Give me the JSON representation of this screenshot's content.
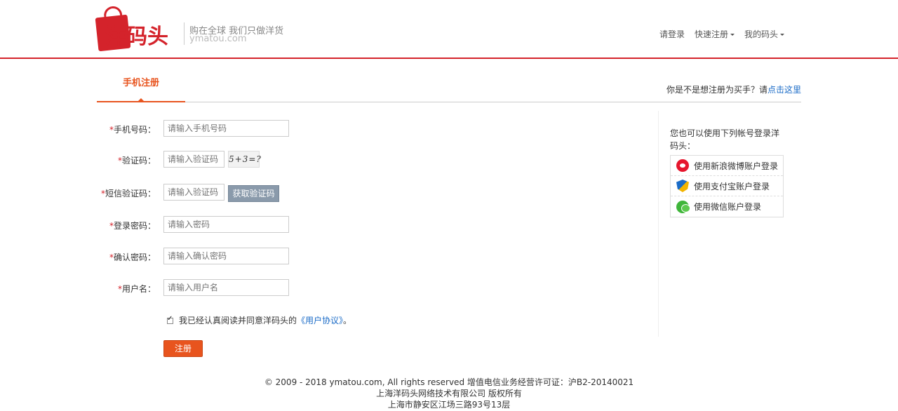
{
  "header": {
    "logo_text": "洋码头",
    "slogan": "购在全球 我们只做洋货",
    "slogan_en": "ymatou.com",
    "nav": [
      {
        "label": "请登录",
        "dropdown": false
      },
      {
        "label": "快速注册",
        "dropdown": true
      },
      {
        "label": "我的码头",
        "dropdown": true
      }
    ]
  },
  "tabs": {
    "active": "手机注册",
    "buyer_hint_prefix": "你是不是想注册为买手？请",
    "buyer_hint_link": "点击这里"
  },
  "form": {
    "required_mark": "*",
    "phone": {
      "label": "手机号码：",
      "placeholder": "请输入手机号码"
    },
    "captcha": {
      "label": "验证码：",
      "placeholder": "请输入验证码",
      "image_text": "5+3=?"
    },
    "sms": {
      "label": "短信验证码：",
      "placeholder": "请输入验证码",
      "button": "获取验证码"
    },
    "password": {
      "label": "登录密码：",
      "placeholder": "请输入密码"
    },
    "confirm": {
      "label": "确认密码：",
      "placeholder": "请输入确认密码"
    },
    "username": {
      "label": "用户名：",
      "placeholder": "请输入用户名"
    },
    "agree_text": "我已经认真阅读并同意洋码头的",
    "agree_link": "《用户协议》",
    "agree_suffix": "。",
    "submit": "注册"
  },
  "side": {
    "title": "您也可以使用下列帐号登录洋码头：",
    "options": [
      {
        "label": "使用新浪微博账户登录",
        "icon": "weibo-icon"
      },
      {
        "label": "使用支付宝账户登录",
        "icon": "alipay-icon"
      },
      {
        "label": "使用微信账户登录",
        "icon": "wechat-icon"
      }
    ]
  },
  "footer": {
    "line1": "© 2009 - 2018 ymatou.com, All rights reserved 增值电信业务经营许可证：沪B2-20140021",
    "line2": "上海洋码头网络技术有限公司 版权所有",
    "line3": "上海市静安区江场三路93号13层"
  },
  "colors": {
    "brand": "#d4232b",
    "accent": "#e8541e",
    "link": "#1a6bc7"
  }
}
